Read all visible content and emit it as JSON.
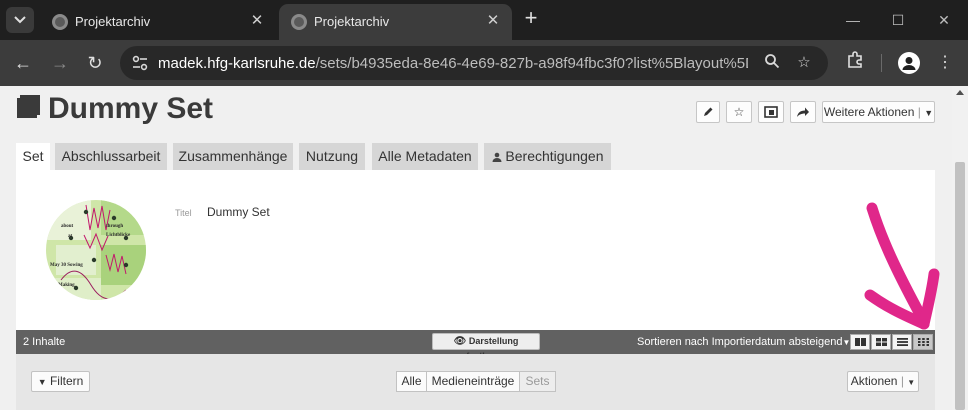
{
  "browser": {
    "tabs": [
      {
        "title": "Projektarchiv",
        "active": false
      },
      {
        "title": "Projektarchiv",
        "active": true
      }
    ],
    "url_host": "madek.hfg-karlsruhe.de",
    "url_path": "/sets/b4935eda-8e46-4e69-827b-a98f94fbc3f0?list%5Blayout%5D=mi..."
  },
  "page": {
    "title": "Dummy Set",
    "more_actions_label": "Weitere Aktionen",
    "tabs": [
      {
        "label": "Set"
      },
      {
        "label": "Abschlussarbeit"
      },
      {
        "label": "Zusammenhänge"
      },
      {
        "label": "Nutzung"
      },
      {
        "label": "Alle Metadaten"
      },
      {
        "label": "Berechtigungen"
      }
    ],
    "meta": {
      "key": "Titel",
      "value": "Dummy Set"
    },
    "thumbnail_text": [
      "about",
      "through",
      "at",
      "Lichtblicke",
      "May 30 Sowing",
      "Making"
    ],
    "content_count": "2 Inhalte",
    "display_button": "Darstellung festlegen",
    "sort_label": "Sortieren nach Importierdatum absteigend",
    "filter_label": "Filtern",
    "segments": [
      "Alle",
      "Medieneinträge",
      "Sets"
    ],
    "actions_label": "Aktionen",
    "annotation_color": "#e0278a"
  }
}
